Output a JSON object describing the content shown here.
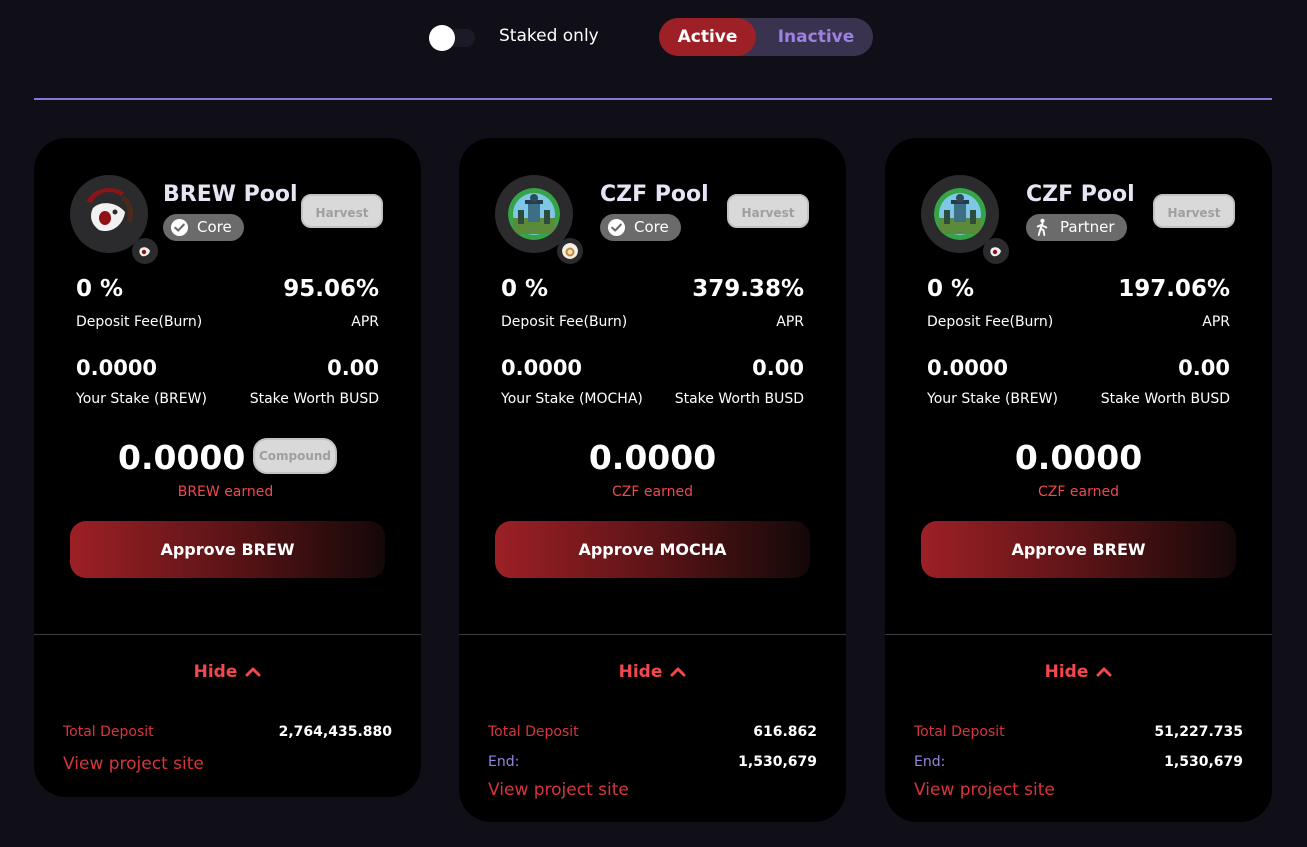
{
  "filters": {
    "staked_only_label": "Staked only",
    "staked_only_on": false,
    "active_label": "Active",
    "inactive_label": "Inactive"
  },
  "pools": [
    {
      "title": "BREW Pool",
      "tag": "Core",
      "tag_icon": "check-circle-icon",
      "harvest_label": "Harvest",
      "deposit_fee": "0 %",
      "deposit_fee_label": "Deposit Fee(Burn)",
      "apr": "95.06%",
      "apr_label": "APR",
      "stake": "0.0000",
      "stake_label": "Your Stake (BREW)",
      "stake_worth": "0.00",
      "stake_worth_label": "Stake Worth BUSD",
      "earned": "0.0000",
      "earned_label": "BREW earned",
      "compound_label": "Compound",
      "approve_label": "Approve BREW",
      "hide_label": "Hide",
      "total_deposit_label": "Total Deposit",
      "total_deposit": "2,764,435.880",
      "view_site_label": "View project site"
    },
    {
      "title": "CZF Pool",
      "tag": "Core",
      "tag_icon": "check-circle-icon",
      "harvest_label": "Harvest",
      "deposit_fee": "0 %",
      "deposit_fee_label": "Deposit Fee(Burn)",
      "apr": "379.38%",
      "apr_label": "APR",
      "stake": "0.0000",
      "stake_label": "Your Stake (MOCHA)",
      "stake_worth": "0.00",
      "stake_worth_label": "Stake Worth BUSD",
      "earned": "0.0000",
      "earned_label": "CZF earned",
      "approve_label": "Approve MOCHA",
      "hide_label": "Hide",
      "total_deposit_label": "Total Deposit",
      "total_deposit": "616.862",
      "end_label": "End:",
      "end": "1,530,679",
      "view_site_label": "View project site"
    },
    {
      "title": "CZF Pool",
      "tag": "Partner",
      "tag_icon": "person-walking-icon",
      "harvest_label": "Harvest",
      "deposit_fee": "0 %",
      "deposit_fee_label": "Deposit Fee(Burn)",
      "apr": "197.06%",
      "apr_label": "APR",
      "stake": "0.0000",
      "stake_label": "Your Stake (BREW)",
      "stake_worth": "0.00",
      "stake_worth_label": "Stake Worth BUSD",
      "earned": "0.0000",
      "earned_label": "CZF earned",
      "approve_label": "Approve BREW",
      "hide_label": "Hide",
      "total_deposit_label": "Total Deposit",
      "total_deposit": "51,227.735",
      "end_label": "End:",
      "end": "1,530,679",
      "view_site_label": "View project site"
    }
  ],
  "colors": {
    "background": "#100e17",
    "card": "#000000",
    "accent_red": "#9c2026",
    "label_red": "#f0484c",
    "purple": "#9a82e0"
  }
}
